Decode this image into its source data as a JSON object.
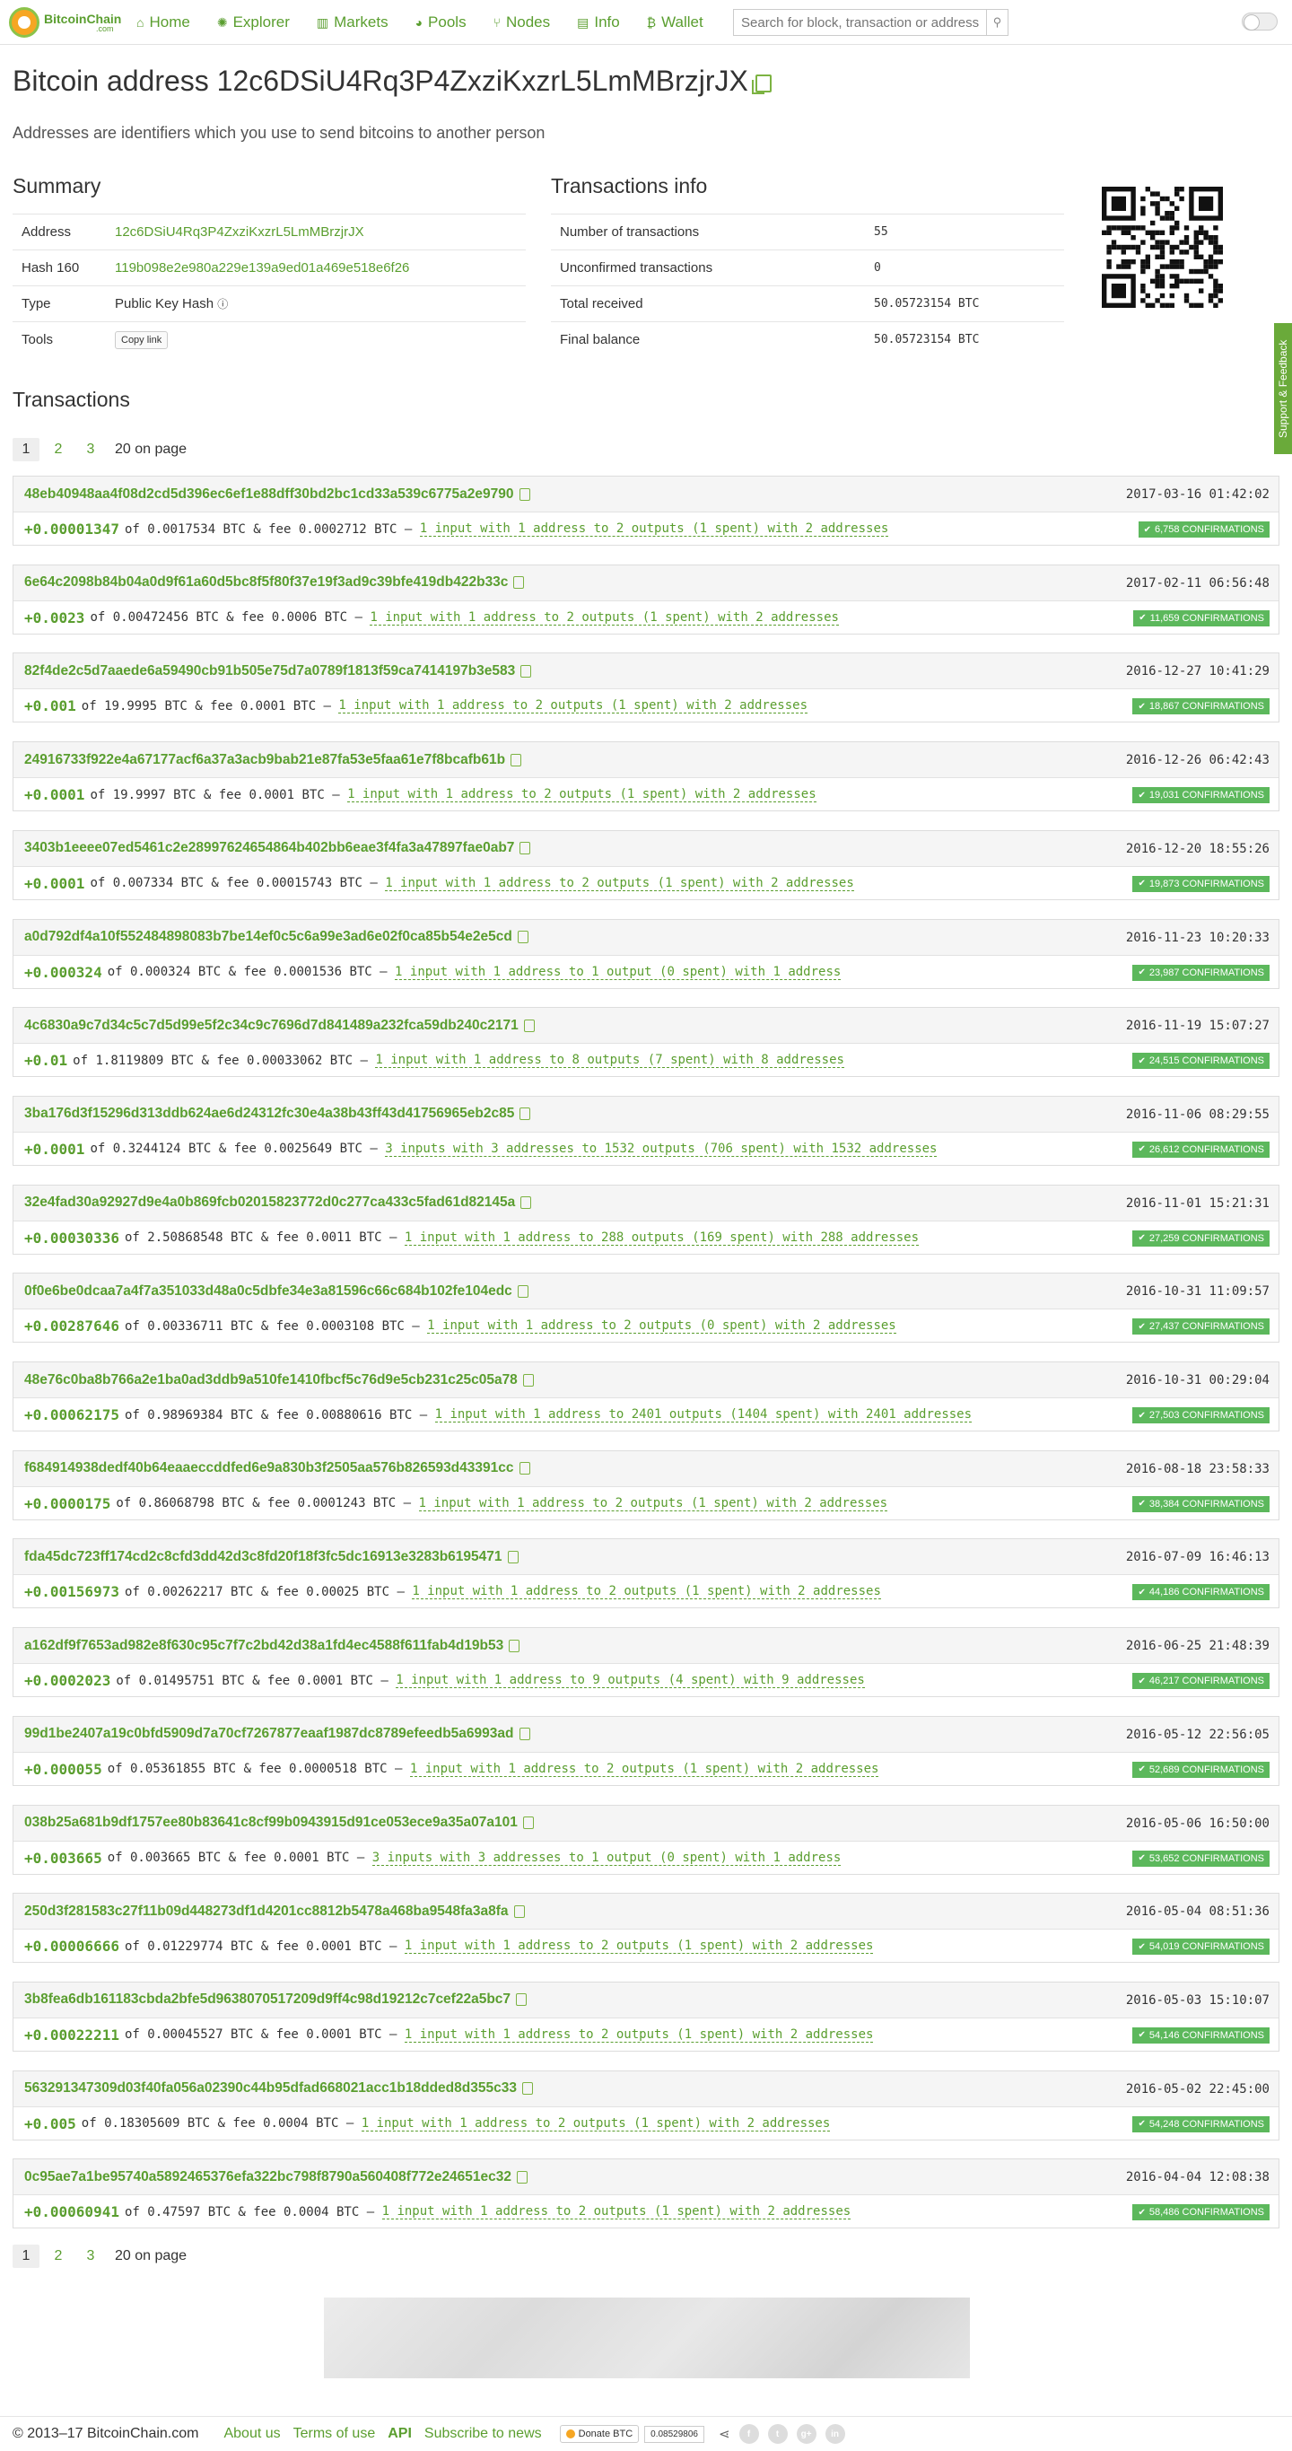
{
  "nav": {
    "brand": "BitcoinChain",
    "brand_sub": ".com",
    "items": [
      {
        "label": "Home",
        "icon": "home-icon"
      },
      {
        "label": "Explorer",
        "icon": "explorer-icon"
      },
      {
        "label": "Markets",
        "icon": "markets-icon"
      },
      {
        "label": "Pools",
        "icon": "pools-icon"
      },
      {
        "label": "Nodes",
        "icon": "nodes-icon"
      },
      {
        "label": "Info",
        "icon": "info-icon"
      },
      {
        "label": "Wallet",
        "icon": "wallet-icon"
      }
    ],
    "search_placeholder": "Search for block, transaction or address"
  },
  "page": {
    "title": "Bitcoin address 12c6DSiU4Rq3P4ZxziKxzrL5LmMBrzjrJX",
    "subtitle": "Addresses are identifiers which you use to send bitcoins to another person"
  },
  "summary": {
    "heading": "Summary",
    "rows": [
      {
        "k": "Address",
        "v": "12c6DSiU4Rq3P4ZxziKxzrL5LmMBrzjrJX"
      },
      {
        "k": "Hash 160",
        "v": "119b098e2e980a229e139a9ed01a469e518e6f26"
      },
      {
        "k": "Type",
        "v": "Public Key Hash"
      },
      {
        "k": "Tools",
        "v": "Copy link"
      }
    ]
  },
  "txinfo": {
    "heading": "Transactions info",
    "rows": [
      {
        "k": "Number of transactions",
        "v": "55"
      },
      {
        "k": "Unconfirmed transactions",
        "v": "0"
      },
      {
        "k": "Total received",
        "v": "50.05723154 BTC"
      },
      {
        "k": "Final balance",
        "v": "50.05723154 BTC"
      }
    ]
  },
  "transactions_heading": "Transactions",
  "pager": {
    "pages": [
      "1",
      "2",
      "3"
    ],
    "on_page": "20 on page"
  },
  "feedback": "Support & Feedback",
  "transactions": [
    {
      "hash": "48eb40948aa4f08d2cd5d396ec6ef1e88dff30bd2bc1cd33a539c6775a2e9790",
      "date": "2017-03-16 01:42:02",
      "amt": "+0.00001347",
      "tot": "0.0017534",
      "fee": "0.0002712",
      "desc": "1 input with 1 address to 2 outputs (1 spent) with 2 addresses",
      "conf": "6,758 CONFIRMATIONS"
    },
    {
      "hash": "6e64c2098b84b04a0d9f61a60d5bc8f5f80f37e19f3ad9c39bfe419db422b33c",
      "date": "2017-02-11 06:56:48",
      "amt": "+0.0023",
      "tot": "0.00472456",
      "fee": "0.0006",
      "desc": "1 input with 1 address to 2 outputs (1 spent) with 2 addresses",
      "conf": "11,659 CONFIRMATIONS"
    },
    {
      "hash": "82f4de2c5d7aaede6a59490cb91b505e75d7a0789f1813f59ca7414197b3e583",
      "date": "2016-12-27 10:41:29",
      "amt": "+0.001",
      "tot": "19.9995",
      "fee": "0.0001",
      "desc": "1 input with 1 address to 2 outputs (1 spent) with 2 addresses",
      "conf": "18,867 CONFIRMATIONS"
    },
    {
      "hash": "24916733f922e4a67177acf6a37a3acb9bab21e87fa53e5faa61e7f8bcafb61b",
      "date": "2016-12-26 06:42:43",
      "amt": "+0.0001",
      "tot": "19.9997",
      "fee": "0.0001",
      "desc": "1 input with 1 address to 2 outputs (1 spent) with 2 addresses",
      "conf": "19,031 CONFIRMATIONS"
    },
    {
      "hash": "3403b1eeee07ed5461c2e28997624654864b402bb6eae3f4fa3a47897fae0ab7",
      "date": "2016-12-20 18:55:26",
      "amt": "+0.0001",
      "tot": "0.007334",
      "fee": "0.00015743",
      "desc": "1 input with 1 address to 2 outputs (1 spent) with 2 addresses",
      "conf": "19,873 CONFIRMATIONS"
    },
    {
      "hash": "a0d792df4a10f552484898083b7be14ef0c5c6a99e3ad6e02f0ca85b54e2e5cd",
      "date": "2016-11-23 10:20:33",
      "amt": "+0.000324",
      "tot": "0.000324",
      "fee": "0.0001536",
      "desc": "1 input with 1 address to 1 output (0 spent) with 1 address",
      "conf": "23,987 CONFIRMATIONS"
    },
    {
      "hash": "4c6830a9c7d34c5c7d5d99e5f2c34c9c7696d7d841489a232fca59db240c2171",
      "date": "2016-11-19 15:07:27",
      "amt": "+0.01",
      "tot": "1.8119809",
      "fee": "0.00033062",
      "desc": "1 input with 1 address to 8 outputs (7 spent) with 8 addresses",
      "conf": "24,515 CONFIRMATIONS"
    },
    {
      "hash": "3ba176d3f15296d313ddb624ae6d24312fc30e4a38b43ff43d41756965eb2c85",
      "date": "2016-11-06 08:29:55",
      "amt": "+0.0001",
      "tot": "0.3244124",
      "fee": "0.0025649",
      "desc": "3 inputs with 3 addresses to 1532 outputs (706 spent) with 1532 addresses",
      "conf": "26,612 CONFIRMATIONS"
    },
    {
      "hash": "32e4fad30a92927d9e4a0b869fcb02015823772d0c277ca433c5fad61d82145a",
      "date": "2016-11-01 15:21:31",
      "amt": "+0.00030336",
      "tot": "2.50868548",
      "fee": "0.0011",
      "desc": "1 input with 1 address to 288 outputs (169 spent) with 288 addresses",
      "conf": "27,259 CONFIRMATIONS"
    },
    {
      "hash": "0f0e6be0dcaa7a4f7a351033d48a0c5dbfe34e3a81596c66c684b102fe104edc",
      "date": "2016-10-31 11:09:57",
      "amt": "+0.00287646",
      "tot": "0.00336711",
      "fee": "0.0003108",
      "desc": "1 input with 1 address to 2 outputs (0 spent) with 2 addresses",
      "conf": "27,437 CONFIRMATIONS"
    },
    {
      "hash": "48e76c0ba8b766a2e1ba0ad3ddb9a510fe1410fbcf5c76d9e5cb231c25c05a78",
      "date": "2016-10-31 00:29:04",
      "amt": "+0.00062175",
      "tot": "0.98969384",
      "fee": "0.00880616",
      "desc": "1 input with 1 address to 2401 outputs (1404 spent) with 2401 addresses",
      "conf": "27,503 CONFIRMATIONS"
    },
    {
      "hash": "f684914938dedf40b64eaaeccddfed6e9a830b3f2505aa576b826593d43391cc",
      "date": "2016-08-18 23:58:33",
      "amt": "+0.0000175",
      "tot": "0.86068798",
      "fee": "0.0001243",
      "desc": "1 input with 1 address to 2 outputs (1 spent) with 2 addresses",
      "conf": "38,384 CONFIRMATIONS"
    },
    {
      "hash": "fda45dc723ff174cd2c8cfd3dd42d3c8fd20f18f3fc5dc16913e3283b6195471",
      "date": "2016-07-09 16:46:13",
      "amt": "+0.00156973",
      "tot": "0.00262217",
      "fee": "0.00025",
      "desc": "1 input with 1 address to 2 outputs (1 spent) with 2 addresses",
      "conf": "44,186 CONFIRMATIONS"
    },
    {
      "hash": "a162df9f7653ad982e8f630c95c7f7c2bd42d38a1fd4ec4588f611fab4d19b53",
      "date": "2016-06-25 21:48:39",
      "amt": "+0.0002023",
      "tot": "0.01495751",
      "fee": "0.0001",
      "desc": "1 input with 1 address to 9 outputs (4 spent) with 9 addresses",
      "conf": "46,217 CONFIRMATIONS"
    },
    {
      "hash": "99d1be2407a19c0bfd5909d7a70cf7267877eaaf1987dc8789efeedb5a6993ad",
      "date": "2016-05-12 22:56:05",
      "amt": "+0.000055",
      "tot": "0.05361855",
      "fee": "0.0000518",
      "desc": "1 input with 1 address to 2 outputs (1 spent) with 2 addresses",
      "conf": "52,689 CONFIRMATIONS"
    },
    {
      "hash": "038b25a681b9df1757ee80b83641c8cf99b0943915d91ce053ece9a35a07a101",
      "date": "2016-05-06 16:50:00",
      "amt": "+0.003665",
      "tot": "0.003665",
      "fee": "0.0001",
      "desc": "3 inputs with 3 addresses to 1 output (0 spent) with 1 address",
      "conf": "53,652 CONFIRMATIONS"
    },
    {
      "hash": "250d3f281583c27f11b09d448273df1d4201cc8812b5478a468ba9548fa3a8fa",
      "date": "2016-05-04 08:51:36",
      "amt": "+0.00006666",
      "tot": "0.01229774",
      "fee": "0.0001",
      "desc": "1 input with 1 address to 2 outputs (1 spent) with 2 addresses",
      "conf": "54,019 CONFIRMATIONS"
    },
    {
      "hash": "3b8fea6db161183cbda2bfe5d9638070517209d9ff4c98d19212c7cef22a5bc7",
      "date": "2016-05-03 15:10:07",
      "amt": "+0.00022211",
      "tot": "0.00045527",
      "fee": "0.0001",
      "desc": "1 input with 1 address to 2 outputs (1 spent) with 2 addresses",
      "conf": "54,146 CONFIRMATIONS"
    },
    {
      "hash": "563291347309d03f40fa056a02390c44b95dfad668021acc1b18dded8d355c33",
      "date": "2016-05-02 22:45:00",
      "amt": "+0.005",
      "tot": "0.18305609",
      "fee": "0.0004",
      "desc": "1 input with 1 address to 2 outputs (1 spent) with 2 addresses",
      "conf": "54,248 CONFIRMATIONS"
    },
    {
      "hash": "0c95ae7a1be95740a5892465376efa322bc798f8790a560408f772e24651ec32",
      "date": "2016-04-04 12:08:38",
      "amt": "+0.00060941",
      "tot": "0.47597",
      "fee": "0.0004",
      "desc": "1 input with 1 address to 2 outputs (1 spent) with 2 addresses",
      "conf": "58,486 CONFIRMATIONS"
    }
  ],
  "footer": {
    "copyright": "© 2013–17 BitcoinChain.com",
    "links": [
      "About us",
      "Terms of use",
      "API",
      "Subscribe to news"
    ],
    "donate": "Donate BTC",
    "rate": "0.08529806"
  }
}
